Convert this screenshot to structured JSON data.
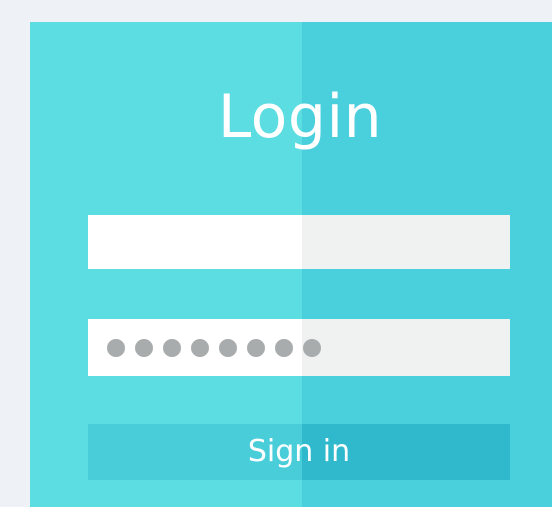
{
  "login": {
    "title": "Login",
    "username": {
      "value": ""
    },
    "password": {
      "masked_length": 8
    },
    "submit_label": "Sign in"
  }
}
